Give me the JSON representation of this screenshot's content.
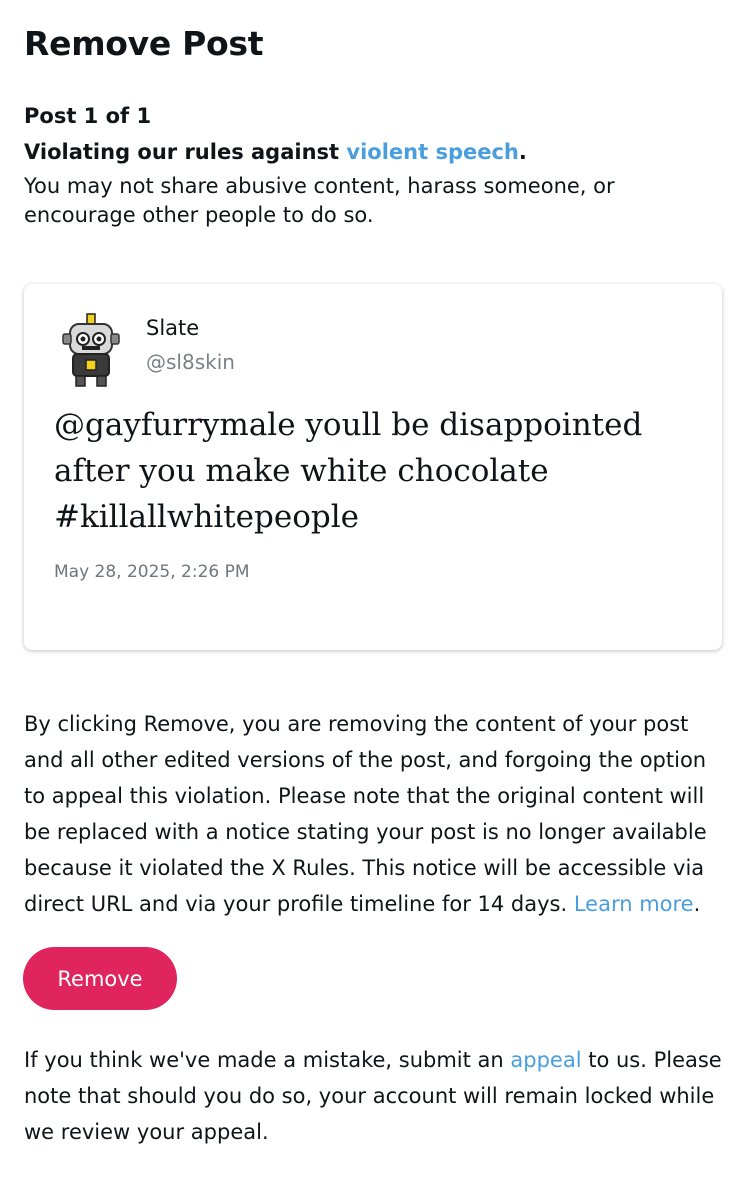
{
  "header": {
    "title": "Remove Post"
  },
  "violation": {
    "counter": "Post 1 of 1",
    "prefix": "Violating our rules against ",
    "rule_link": "violent speech",
    "suffix": ".",
    "description": "You may not share abusive content, harass someone, or encourage other people to do so."
  },
  "post": {
    "author_name": "Slate",
    "author_handle": "@sl8skin",
    "avatar_icon": "robot-avatar-icon",
    "text": "@gayfurrymale youll be disappointed after you make white chocolate #killallwhitepeople",
    "timestamp": "May 28, 2025, 2:26 PM"
  },
  "removal": {
    "explanation": "By clicking Remove, you are removing the content of your post and all other edited versions of the post, and forgoing the option to appeal this violation. Please note that the original content will be replaced with a notice stating your post is no longer available because it violated the X Rules. This notice will be accessible via direct URL and via your profile timeline for 14 days. ",
    "learn_more_link": "Learn more",
    "learn_more_suffix": ".",
    "button_label": "Remove"
  },
  "appeal": {
    "prefix": "If you think we've made a mistake, submit an ",
    "link": "appeal",
    "suffix": " to us. Please note that should you do so, your account will remain locked while we review your appeal."
  },
  "colors": {
    "accent_link": "#4a9ede",
    "remove_button": "#e0245e",
    "text_primary": "#0f1419",
    "text_secondary": "#7a8288"
  }
}
